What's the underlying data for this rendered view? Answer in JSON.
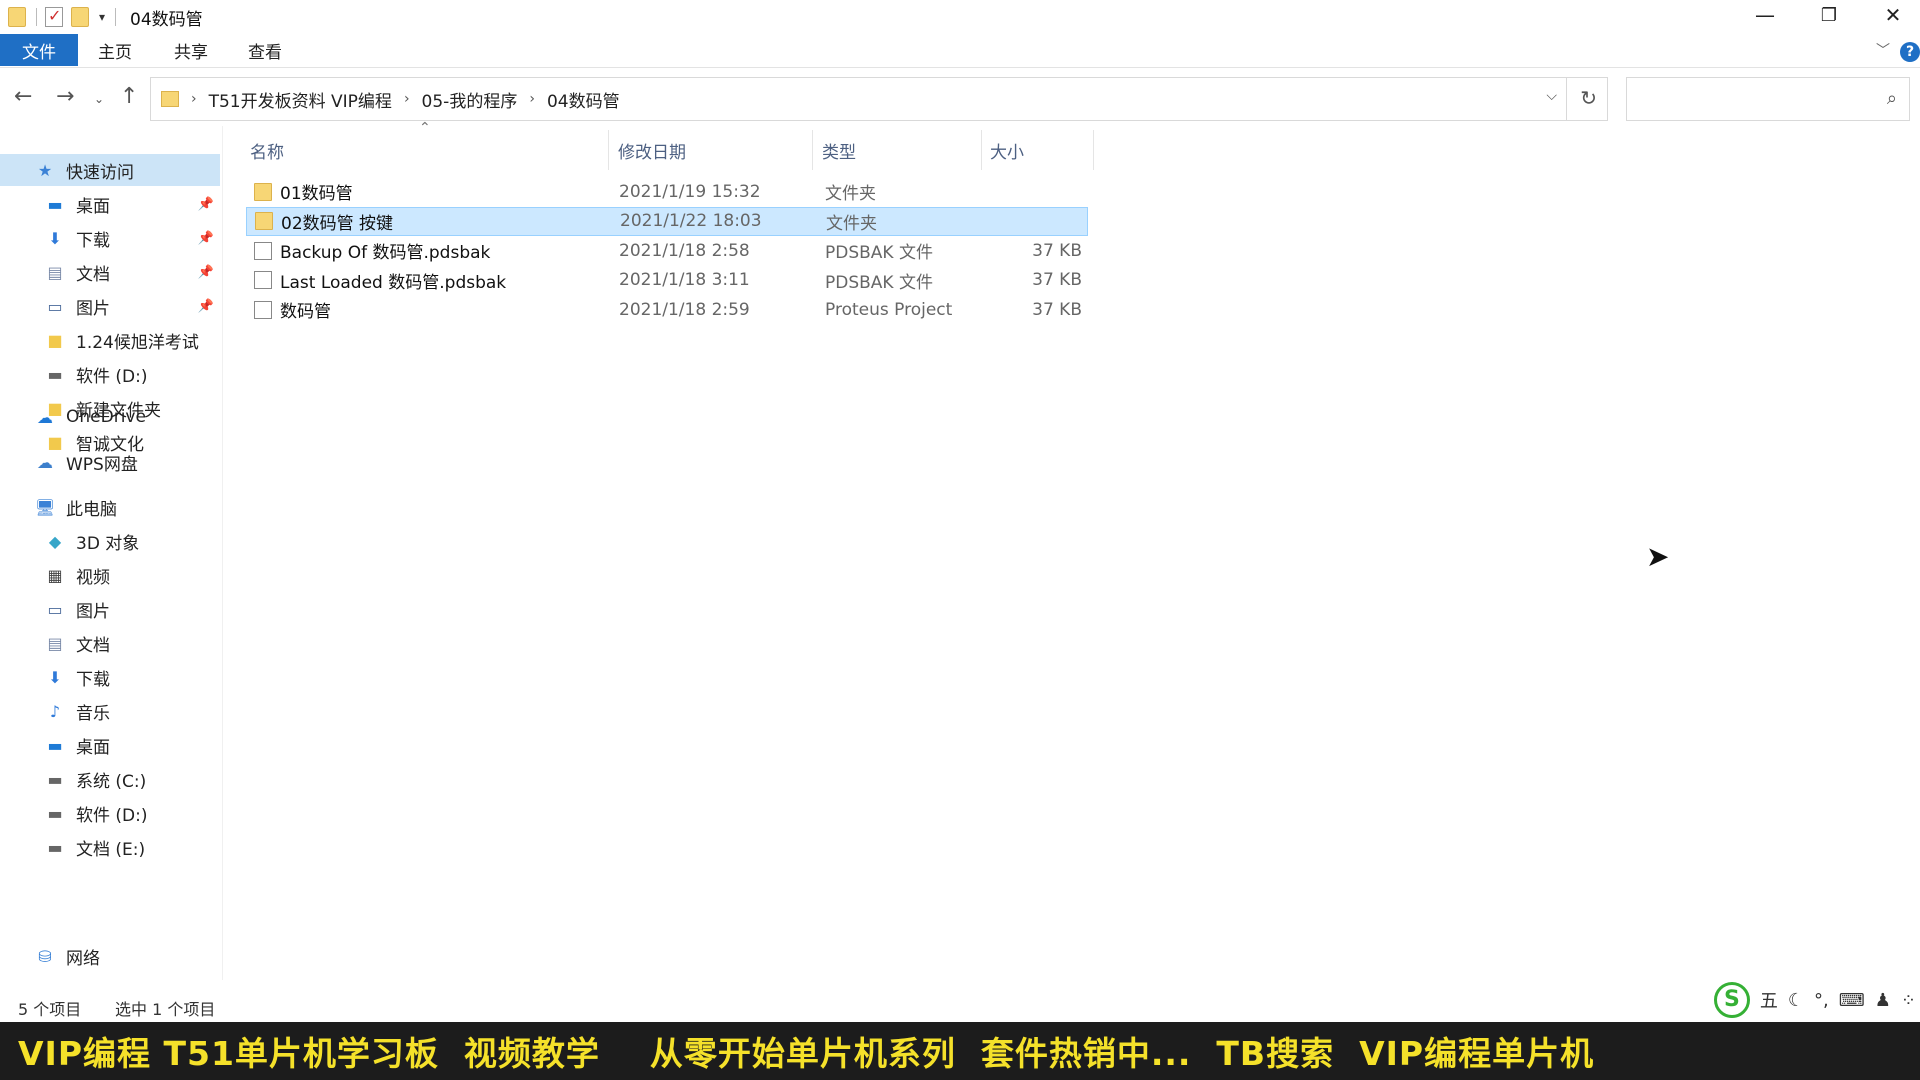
{
  "window": {
    "title": "04数码管",
    "minimize": "—",
    "restore": "❐",
    "close": "✕"
  },
  "ribbon": {
    "tabs": [
      "文件",
      "主页",
      "共享",
      "查看"
    ],
    "expand_icon": "chevron-down-icon",
    "help": "?"
  },
  "address": {
    "crumbs": [
      "T51开发板资料 VIP编程",
      "05-我的程序",
      "04数码管"
    ],
    "search_placeholder": ""
  },
  "sidebar": {
    "quick_access": "快速访问",
    "quick_items": [
      {
        "label": "桌面",
        "pinned": true,
        "icon": "desktop-icon"
      },
      {
        "label": "下载",
        "pinned": true,
        "icon": "download-icon"
      },
      {
        "label": "文档",
        "pinned": true,
        "icon": "document-icon"
      },
      {
        "label": "图片",
        "pinned": true,
        "icon": "picture-icon"
      },
      {
        "label": "1.24候旭洋考试",
        "pinned": false,
        "icon": "folder-icon"
      },
      {
        "label": "软件 (D:)",
        "pinned": false,
        "icon": "drive-icon"
      },
      {
        "label": "新建文件夹",
        "pinned": false,
        "icon": "folder-icon"
      },
      {
        "label": "智诚文化",
        "pinned": false,
        "icon": "folder-icon"
      }
    ],
    "onedrive": "OneDrive",
    "wps": "WPS网盘",
    "this_pc": "此电脑",
    "pc_items": [
      {
        "label": "3D 对象",
        "icon": "3d-objects-icon"
      },
      {
        "label": "视频",
        "icon": "video-icon"
      },
      {
        "label": "图片",
        "icon": "picture-icon"
      },
      {
        "label": "文档",
        "icon": "document-icon"
      },
      {
        "label": "下载",
        "icon": "download-icon"
      },
      {
        "label": "音乐",
        "icon": "music-icon"
      },
      {
        "label": "桌面",
        "icon": "desktop-icon"
      },
      {
        "label": "系统 (C:)",
        "icon": "drive-icon"
      },
      {
        "label": "软件 (D:)",
        "icon": "drive-icon"
      },
      {
        "label": "文档 (E:)",
        "icon": "drive-icon"
      }
    ],
    "network": "网络"
  },
  "columns": {
    "name": "名称",
    "date": "修改日期",
    "type": "类型",
    "size": "大小"
  },
  "files": [
    {
      "name": "01数码管",
      "date": "2021/1/19 15:32",
      "type": "文件夹",
      "size": "",
      "kind": "folder",
      "selected": false
    },
    {
      "name": "02数码管 按键",
      "date": "2021/1/22 18:03",
      "type": "文件夹",
      "size": "",
      "kind": "folder",
      "selected": true
    },
    {
      "name": "Backup Of 数码管.pdsbak",
      "date": "2021/1/18 2:58",
      "type": "PDSBAK 文件",
      "size": "37 KB",
      "kind": "file",
      "selected": false
    },
    {
      "name": "Last Loaded 数码管.pdsbak",
      "date": "2021/1/18 3:11",
      "type": "PDSBAK 文件",
      "size": "37 KB",
      "kind": "file",
      "selected": false
    },
    {
      "name": "数码管",
      "date": "2021/1/18 2:59",
      "type": "Proteus Project",
      "size": "37 KB",
      "kind": "project",
      "selected": false
    }
  ],
  "status": {
    "count": "5 个项目",
    "selection": "选中 1 个项目"
  },
  "ime": {
    "logo": "S",
    "mode": "五",
    "items": [
      "☾",
      "°,",
      "⌨",
      "♟",
      "⁘"
    ]
  },
  "banner": {
    "text": "VIP编程 T51单片机学习板  视频教学    从零开始单片机系列  套件热销中...  TB搜索  VIP编程单片机"
  },
  "colors": {
    "accent": "#1f6fc5",
    "selection": "#cce8ff",
    "banner_text": "#f5e12a",
    "banner_bg": "#1c1c1c"
  }
}
